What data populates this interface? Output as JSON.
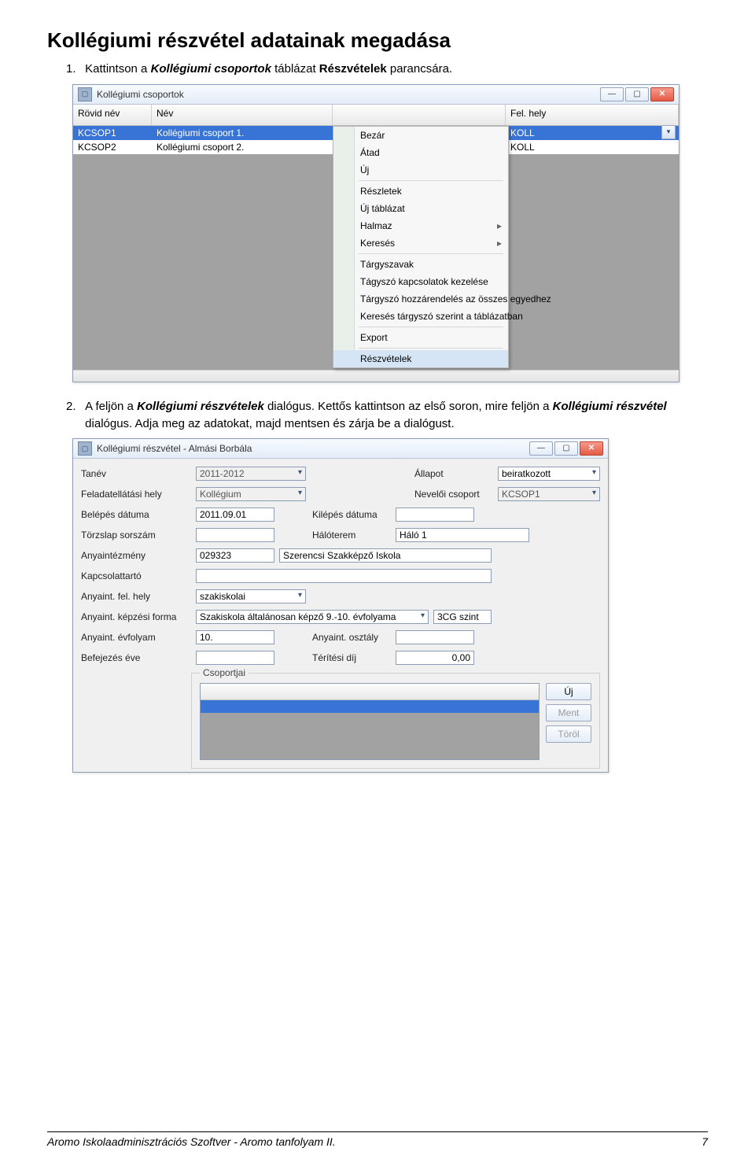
{
  "page": {
    "title": "Kollégiumi részvétel adatainak megadása",
    "step1_prefix": "Kattintson a ",
    "step1_em": "Kollégiumi csoportok",
    "step1_mid": " táblázat ",
    "step1_b": "Részvételek",
    "step1_suffix": " parancsára.",
    "step2_prefix": "A feljön a ",
    "step2_em": "Kollégiumi részvételek",
    "step2_mid": " dialógus. Kettős kattintson az első soron, mire feljön a ",
    "step2_em2": "Kollégiumi részvétel",
    "step2_suffix": " dialógus. Adja meg az adatokat, majd mentsen és zárja be a dialógust."
  },
  "win1": {
    "title": "Kollégiumi csoportok",
    "cols": {
      "c1": "Rövid név",
      "c2": "Név",
      "c3": "",
      "c4": "Fel. hely"
    },
    "rows": [
      {
        "c1": "KCSOP1",
        "c2": "Kollégiumi csoport 1.",
        "c4": "KOLL",
        "sel": true
      },
      {
        "c1": "KCSOP2",
        "c2": "Kollégiumi csoport 2.",
        "c4": "KOLL",
        "sel": false
      }
    ],
    "menu": [
      {
        "t": "Bezár"
      },
      {
        "t": "Átad"
      },
      {
        "t": "Új"
      },
      {
        "sep": true
      },
      {
        "t": "Részletek"
      },
      {
        "t": "Új táblázat"
      },
      {
        "t": "Halmaz",
        "sub": true
      },
      {
        "t": "Keresés",
        "sub": true
      },
      {
        "sep": true
      },
      {
        "t": "Tárgyszavak"
      },
      {
        "t": "Tágyszó kapcsolatok kezelése"
      },
      {
        "t": "Tárgyszó hozzárendelés az összes egyedhez"
      },
      {
        "t": "Keresés tárgyszó szerint a táblázatban"
      },
      {
        "sep": true
      },
      {
        "t": "Export"
      },
      {
        "sep": true
      },
      {
        "t": "Részvételek",
        "hi": true
      }
    ]
  },
  "win2": {
    "title": "Kollégiumi részvétel - Almási Borbála",
    "labels": {
      "tanev": "Tanév",
      "allapot": "Állapot",
      "felhely": "Feladatellátási hely",
      "nevcsop": "Nevelői csoport",
      "belep": "Belépés dátuma",
      "kilep": "Kilépés dátuma",
      "torzslap": "Törzslap sorszám",
      "haloterem": "Hálóterem",
      "anyaint": "Anyaintézmény",
      "kapcs": "Kapcsolattartó",
      "anyaintfh": "Anyaint. fel. hely",
      "kepzforma": "Anyaint. képzési forma",
      "anyaevf": "Anyaint. évfolyam",
      "anyaoszt": "Anyaint. osztály",
      "befev": "Befejezés éve",
      "terdij": "Térítési díj",
      "csoportjai": "Csoportjai"
    },
    "values": {
      "tanev": "2011-2012",
      "allapot": "beiratkozott",
      "felhely": "Kollégium",
      "nevcsop": "KCSOP1",
      "belep": "2011.09.01",
      "kilep": "",
      "torzslap": "",
      "haloterem": "Háló 1",
      "anyaint_kod": "029323",
      "anyaint_nev": "Szerencsi Szakképző Iskola",
      "kapcs": "",
      "anyaintfh": "szakiskolai",
      "kepzforma": "Szakiskola általánosan képző 9.-10. évfolyama",
      "szint": "3CG szint",
      "anyaevf": "10.",
      "anyaoszt": "",
      "befev": "",
      "terdij": "0,00"
    },
    "buttons": {
      "uj": "Új",
      "ment": "Ment",
      "torol": "Töröl"
    }
  },
  "footer": {
    "left": "Aromo Iskolaadminisztrációs Szoftver - Aromo tanfolyam II.",
    "right": "7"
  }
}
